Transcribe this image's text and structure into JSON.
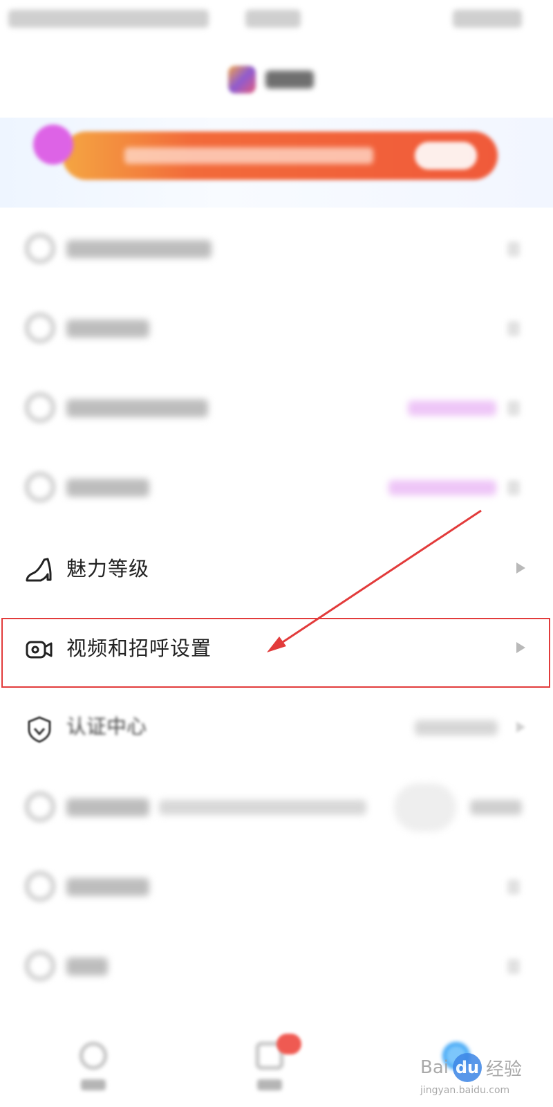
{
  "menu": {
    "charm_level": {
      "label": "魅力等级",
      "icon": "high-heel-icon"
    },
    "video_greeting_settings": {
      "label": "视频和招呼设置",
      "icon": "video-camera-icon"
    },
    "verification_center": {
      "label": "认证中心",
      "icon": "shield-check-icon"
    }
  },
  "watermark": {
    "brand": "Bai",
    "paw": "du",
    "suffix": "经验",
    "url": "jingyan.baidu.com"
  },
  "colors": {
    "highlight": "#e23b3b",
    "promo_banner": "#f26a3a",
    "tag_purple": "#e9b7f5",
    "active_tab": "#3aa3f5"
  }
}
